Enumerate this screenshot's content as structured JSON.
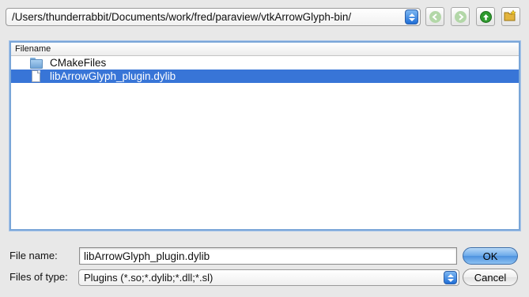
{
  "path_bar": {
    "value": "/Users/thunderrabbit/Documents/work/fred/paraview/vtkArrowGlyph-bin/"
  },
  "nav_buttons": {
    "back_icon": "back-arrow-icon",
    "forward_icon": "forward-arrow-icon",
    "up_icon": "up-arrow-icon",
    "new_folder_icon": "new-folder-icon"
  },
  "file_list": {
    "header": "Filename",
    "items": [
      {
        "name": "CMakeFiles",
        "icon": "folder-icon",
        "selected": false
      },
      {
        "name": "libArrowGlyph_plugin.dylib",
        "icon": "document-icon",
        "selected": true
      }
    ]
  },
  "form": {
    "file_name_label": "File name:",
    "file_name_value": "libArrowGlyph_plugin.dylib",
    "file_type_label": "Files of type:",
    "file_type_value": "Plugins (*.so;*.dylib;*.dll;*.sl)"
  },
  "buttons": {
    "ok": "OK",
    "cancel": "Cancel"
  },
  "colors": {
    "selection": "#3875d7",
    "nav_green": "#2e9a2e",
    "nav_green_disabled": "#b3d7a8"
  }
}
